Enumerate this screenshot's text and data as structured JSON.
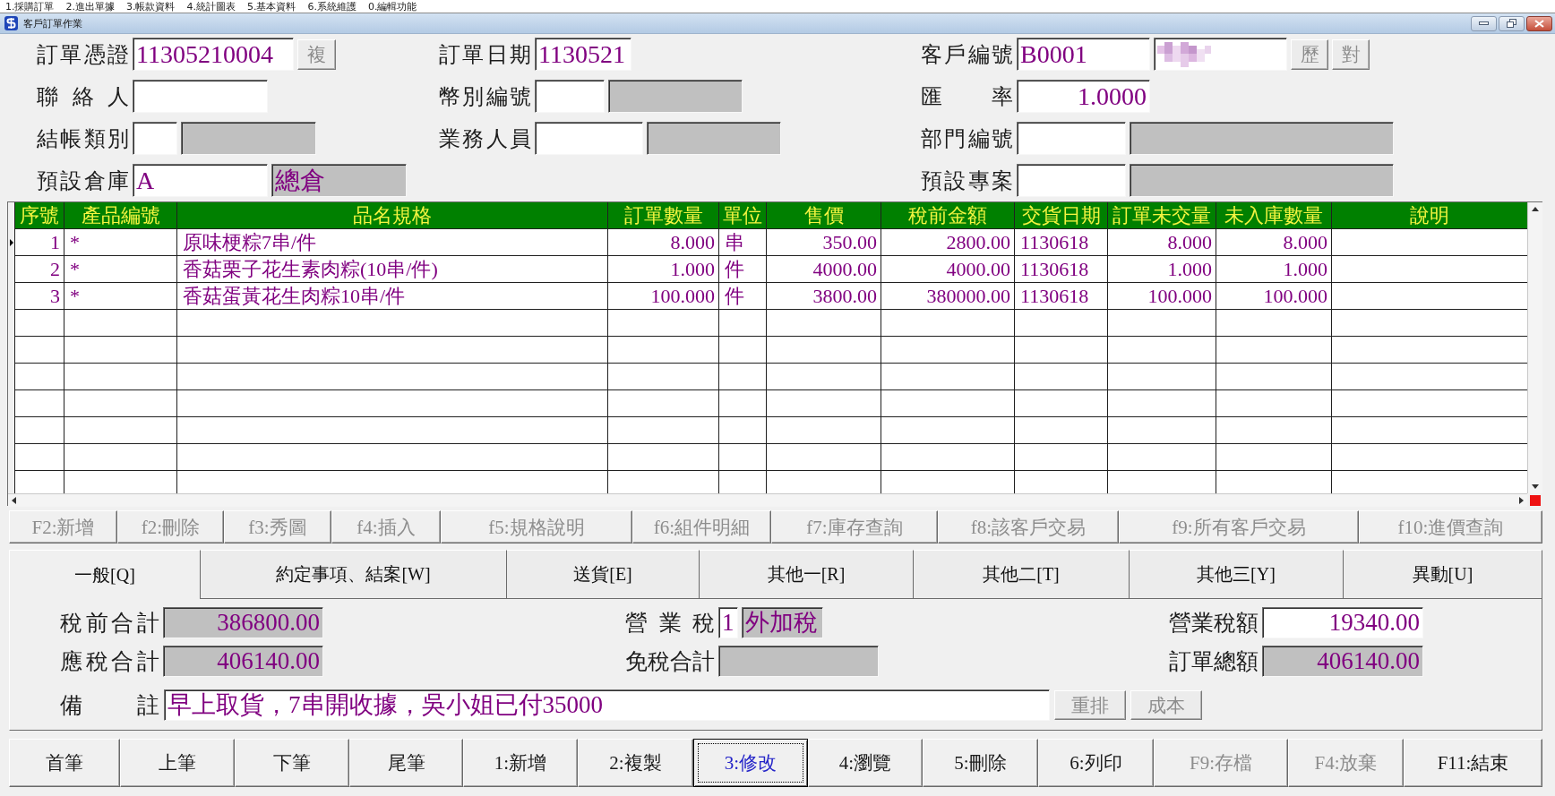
{
  "menu_bar": [
    "1.採購訂單",
    "2.進出單據",
    "3.帳款資料",
    "4.統計圖表",
    "5.基本資料",
    "6.系統維護",
    "0.編輯功能"
  ],
  "window": {
    "title": "客戶訂單作業"
  },
  "order_header": {
    "voucher": {
      "label": "訂單憑證",
      "value": "11305210004",
      "button": {
        "label": "複",
        "disabled": true
      }
    },
    "order_date": {
      "label": "訂單日期",
      "value": "1130521"
    },
    "customer": {
      "label": "客戶編號",
      "code": "B0001",
      "name_redacted": true,
      "buttons": [
        {
          "label": "歷",
          "disabled": true
        },
        {
          "label": "對",
          "disabled": true
        }
      ]
    },
    "contact": {
      "label": "聯 絡 人"
    },
    "currency": {
      "label": "幣別編號"
    },
    "exchange_rate": {
      "label": "匯 率",
      "value": "1.0000"
    },
    "billing_type": {
      "label": "結帳類別"
    },
    "salesperson": {
      "label": "業務人員"
    },
    "department": {
      "label": "部門編號"
    },
    "warehouse": {
      "label": "預設倉庫",
      "code": "A",
      "name": "總倉"
    },
    "project": {
      "label": "預設專案"
    }
  },
  "order_lines": {
    "columns": [
      {
        "label": "序號"
      },
      {
        "label": "產品編號"
      },
      {
        "label": "品名規格"
      },
      {
        "label": "訂單數量"
      },
      {
        "label": "單位"
      },
      {
        "label": "售價"
      },
      {
        "label": "稅前金額"
      },
      {
        "label": "交貨日期"
      },
      {
        "label": "訂單未交量"
      },
      {
        "label": "未入庫數量"
      },
      {
        "label": "說明"
      }
    ],
    "rows": [
      {
        "selected": true,
        "cells": [
          "1",
          "*",
          "原味梗粽7串/件",
          "8.000",
          "串",
          "350.00",
          "2800.00",
          "1130618",
          "8.000",
          "8.000"
        ]
      },
      {
        "selected": false,
        "cells": [
          "2",
          "*",
          "香菇栗子花生素肉粽(10串/件)",
          "1.000",
          "件",
          "4000.00",
          "4000.00",
          "1130618",
          "1.000",
          "1.000"
        ]
      },
      {
        "selected": false,
        "cells": [
          "3",
          "*",
          "香菇蛋黃花生肉粽10串/件",
          "100.000",
          "件",
          "3800.00",
          "380000.00",
          "1130618",
          "100.000",
          "100.000"
        ]
      }
    ]
  },
  "function_keys": [
    {
      "label": "F2:新增",
      "disabled": true
    },
    {
      "label": "f2:刪除",
      "disabled": true
    },
    {
      "label": "f3:秀圖",
      "disabled": true
    },
    {
      "label": "f4:插入",
      "disabled": true
    },
    {
      "label": "f5:規格說明",
      "disabled": true
    },
    {
      "label": "f6:組件明細",
      "disabled": true
    },
    {
      "label": "f7:庫存查詢",
      "disabled": true
    },
    {
      "label": "f8:該客戶交易",
      "disabled": true
    },
    {
      "label": "f9:所有客戶交易",
      "disabled": true
    },
    {
      "label": "f10:進價查詢",
      "disabled": true
    }
  ],
  "tabs": [
    {
      "label": "一般[Q]",
      "selected": true
    },
    {
      "label": "約定事項、結案[W]",
      "selected": false
    },
    {
      "label": "送貨[E]",
      "selected": false
    },
    {
      "label": "其他一[R]",
      "selected": false
    },
    {
      "label": "其他二[T]",
      "selected": false
    },
    {
      "label": "其他三[Y]",
      "selected": false
    },
    {
      "label": "異動[U]",
      "selected": false
    }
  ],
  "totals": {
    "pretax_total": {
      "label": "稅前合計",
      "value": "386800.00"
    },
    "tax_type": {
      "label": "營 業 稅",
      "code": "1",
      "name": "外加稅"
    },
    "tax_amount": {
      "label": "營業稅額",
      "value": "19340.00"
    },
    "taxable_total": {
      "label": "應稅合計",
      "value": "406140.00"
    },
    "tax_free_total": {
      "label": "免稅合計"
    },
    "order_total": {
      "label": "訂單總額",
      "value": "406140.00"
    },
    "remarks": {
      "label": "備 註",
      "value": "早上取貨，7串開收據，吳小姐已付35000"
    },
    "buttons": [
      {
        "label": "重排",
        "disabled": true
      },
      {
        "label": "成本",
        "disabled": true
      }
    ]
  },
  "nav_buttons": [
    {
      "label": "首筆",
      "disabled": false,
      "focused": false
    },
    {
      "label": "上筆",
      "disabled": false,
      "focused": false
    },
    {
      "label": "下筆",
      "disabled": false,
      "focused": false
    },
    {
      "label": "尾筆",
      "disabled": false,
      "focused": false
    },
    {
      "label": "1:新增",
      "disabled": false,
      "focused": false
    },
    {
      "label": "2:複製",
      "disabled": false,
      "focused": false
    },
    {
      "label": "3:修改",
      "disabled": false,
      "focused": true
    },
    {
      "label": "4:瀏覽",
      "disabled": false,
      "focused": false
    },
    {
      "label": "5:刪除",
      "disabled": false,
      "focused": false
    },
    {
      "label": "6:列印",
      "disabled": false,
      "focused": false
    },
    {
      "label": "F9:存檔",
      "disabled": true,
      "focused": false
    },
    {
      "label": "F4:放棄",
      "disabled": true,
      "focused": false
    },
    {
      "label": "F11:結束",
      "disabled": false,
      "focused": false
    }
  ]
}
